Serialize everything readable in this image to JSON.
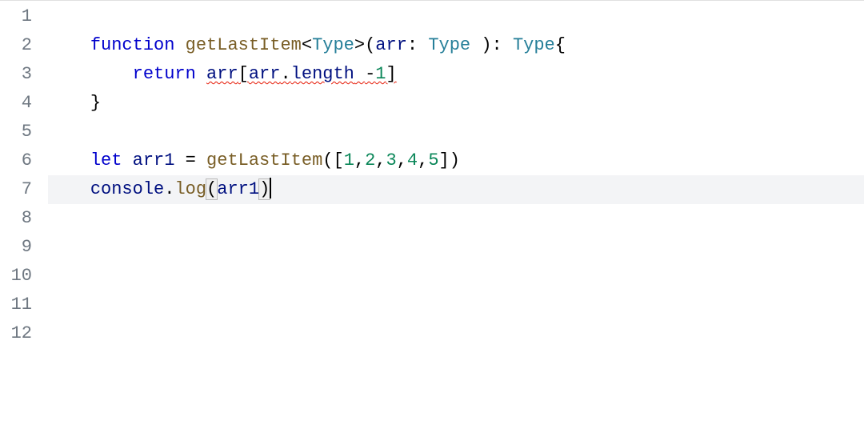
{
  "editor": {
    "line_count": 12,
    "current_line": 7,
    "cursor_line": 7,
    "lines": {
      "1": [],
      "2": [
        {
          "indent": "    "
        },
        {
          "t": "function",
          "cls": "tok-keyword"
        },
        {
          "t": " ",
          "cls": "tok-plain"
        },
        {
          "t": "getLastItem",
          "cls": "tok-func"
        },
        {
          "t": "<",
          "cls": "tok-punc"
        },
        {
          "t": "Type",
          "cls": "tok-type"
        },
        {
          "t": ">(",
          "cls": "tok-punc"
        },
        {
          "t": "arr",
          "cls": "tok-ident"
        },
        {
          "t": ": ",
          "cls": "tok-plain"
        },
        {
          "t": "Type",
          "cls": "tok-type"
        },
        {
          "t": " ): ",
          "cls": "tok-punc"
        },
        {
          "t": "Type",
          "cls": "tok-type"
        },
        {
          "t": "{",
          "cls": "tok-punc"
        }
      ],
      "3": [
        {
          "indent": "        "
        },
        {
          "t": "return",
          "cls": "tok-keyword"
        },
        {
          "t": " ",
          "cls": "tok-plain"
        },
        {
          "t": "arr",
          "cls": "tok-ident",
          "err": true
        },
        {
          "t": "[",
          "cls": "tok-punc",
          "err": true
        },
        {
          "t": "arr",
          "cls": "tok-ident",
          "err": true
        },
        {
          "t": ".",
          "cls": "tok-punc",
          "err": true
        },
        {
          "t": "length",
          "cls": "tok-ident",
          "err": true
        },
        {
          "t": " ",
          "cls": "tok-plain",
          "err": true
        },
        {
          "t": "-",
          "cls": "tok-op",
          "err": true
        },
        {
          "t": "1",
          "cls": "tok-num",
          "err": true
        },
        {
          "t": "]",
          "cls": "tok-punc",
          "err": true
        }
      ],
      "4": [
        {
          "indent": "    "
        },
        {
          "t": "}",
          "cls": "tok-punc"
        }
      ],
      "5": [],
      "6": [
        {
          "indent": "    "
        },
        {
          "t": "let",
          "cls": "tok-keyword"
        },
        {
          "t": " ",
          "cls": "tok-plain"
        },
        {
          "t": "arr1",
          "cls": "tok-var"
        },
        {
          "t": " = ",
          "cls": "tok-plain"
        },
        {
          "t": "getLastItem",
          "cls": "tok-func"
        },
        {
          "t": "([",
          "cls": "tok-punc"
        },
        {
          "t": "1",
          "cls": "tok-num"
        },
        {
          "t": ",",
          "cls": "tok-punc"
        },
        {
          "t": "2",
          "cls": "tok-num"
        },
        {
          "t": ",",
          "cls": "tok-punc"
        },
        {
          "t": "3",
          "cls": "tok-num"
        },
        {
          "t": ",",
          "cls": "tok-punc"
        },
        {
          "t": "4",
          "cls": "tok-num"
        },
        {
          "t": ",",
          "cls": "tok-punc"
        },
        {
          "t": "5",
          "cls": "tok-num"
        },
        {
          "t": "])",
          "cls": "tok-punc"
        }
      ],
      "7": [
        {
          "indent": "    "
        },
        {
          "t": "console",
          "cls": "tok-ident"
        },
        {
          "t": ".",
          "cls": "tok-punc"
        },
        {
          "t": "log",
          "cls": "tok-func"
        },
        {
          "t": "(",
          "cls": "tok-punc",
          "match": true
        },
        {
          "t": "arr1",
          "cls": "tok-ident"
        },
        {
          "t": ")",
          "cls": "tok-punc",
          "match": true
        },
        {
          "cursor": true
        }
      ],
      "8": [],
      "9": [],
      "10": [],
      "11": [],
      "12": []
    }
  }
}
